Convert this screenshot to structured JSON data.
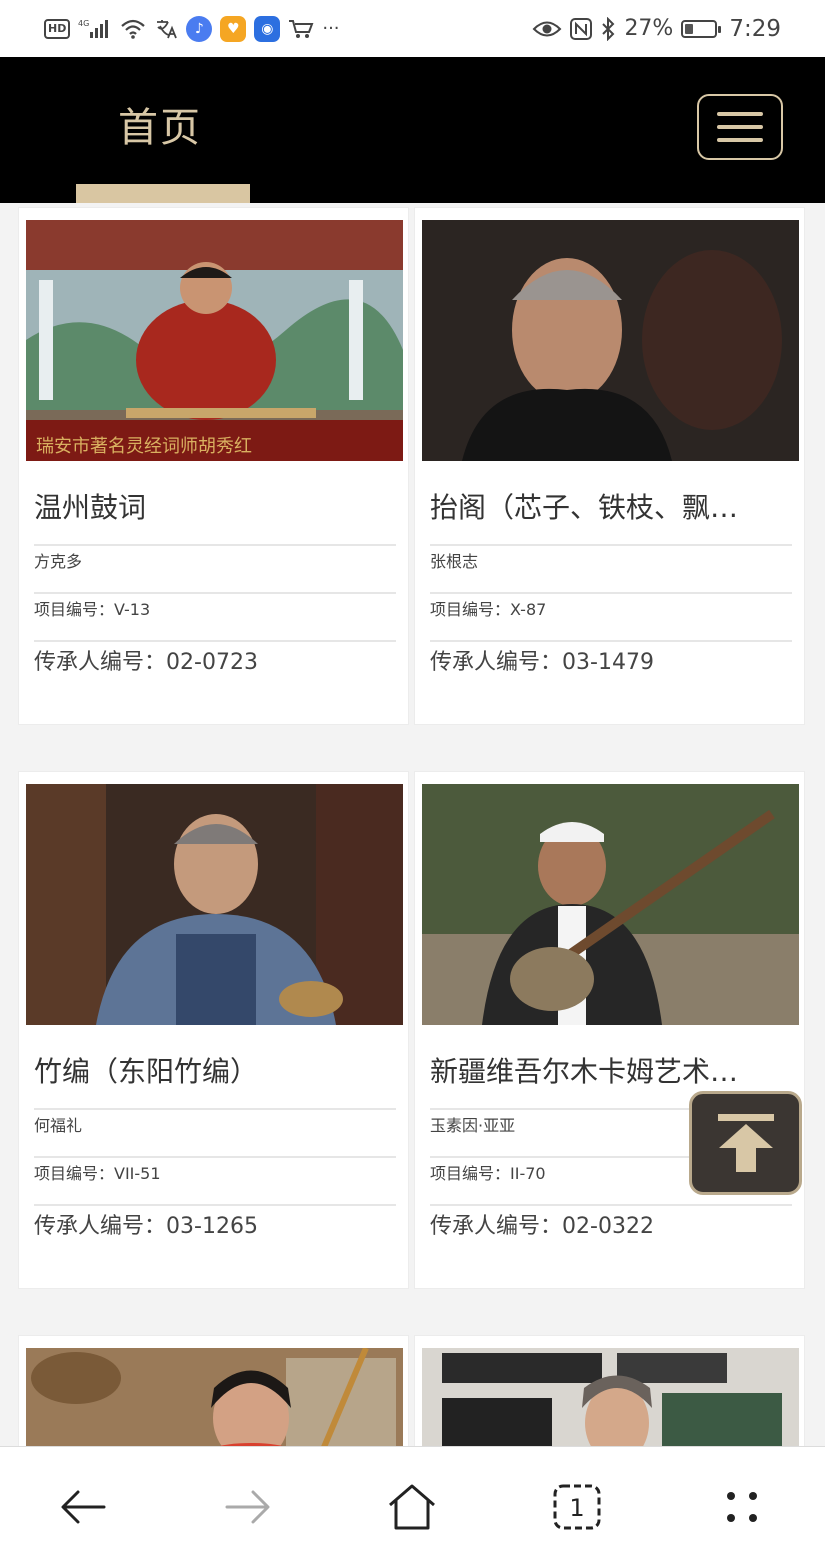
{
  "status_bar": {
    "network": "4G",
    "hd": "HD",
    "battery_text": "27%",
    "battery_level": 0.27,
    "time": "7:29",
    "more": "···"
  },
  "header": {
    "title": "首页"
  },
  "cards": [
    {
      "title": "温州鼓词",
      "name": "方克多",
      "project_label": "项目编号：",
      "project_no": "V-13",
      "heir_label": "传承人编号：",
      "heir_no": "02-0723"
    },
    {
      "title": "抬阁（芯子、铁枝、飘…",
      "name": "张根志",
      "project_label": "项目编号：",
      "project_no": "X-87",
      "heir_label": "传承人编号：",
      "heir_no": "03-1479"
    },
    {
      "title": "竹编（东阳竹编）",
      "name": "何福礼",
      "project_label": "项目编号：",
      "project_no": "VII-51",
      "heir_label": "传承人编号：",
      "heir_no": "03-1265"
    },
    {
      "title": "新疆维吾尔木卡姆艺术…",
      "name": "玉素因·亚亚",
      "project_label": "项目编号：",
      "project_no": "II-70",
      "heir_label": "传承人编号：",
      "heir_no": "02-0322"
    }
  ],
  "colors": {
    "header_bg": "#000000",
    "accent_gold": "#d8c7a6",
    "page_bg": "#f3f3f3"
  }
}
